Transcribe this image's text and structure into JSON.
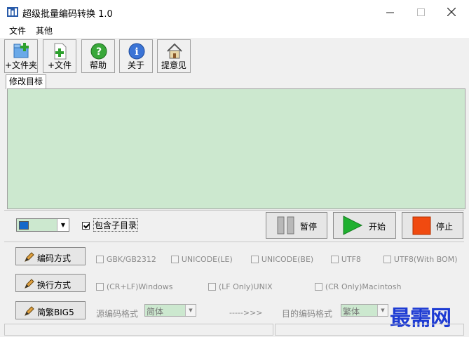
{
  "window": {
    "title": "超级批量编码转换 1.0"
  },
  "menu": [
    "文件",
    "其他"
  ],
  "toolbar": [
    {
      "label": "+文件夹",
      "icon": "add-folder-icon"
    },
    {
      "label": "+文件",
      "icon": "add-file-icon"
    },
    {
      "label": "帮助",
      "icon": "help-icon"
    },
    {
      "label": "关于",
      "icon": "info-icon"
    },
    {
      "label": "提意见",
      "icon": "home-icon"
    }
  ],
  "tab": {
    "label": "修改目标"
  },
  "colors": {
    "panel_bg": "#cce8cf",
    "start_green": "#20b030",
    "stop_orange": "#f04a10",
    "watermark": "#1d3bd3"
  },
  "controls": {
    "include_subdir_label": "包含子目录",
    "include_subdir_checked": true,
    "pause_label": "暂停",
    "start_label": "开始",
    "stop_label": "停止"
  },
  "encoding": {
    "button_label": "编码方式",
    "options": [
      "GBK/GB2312",
      "UNICODE(LE)",
      "UNICODE(BE)",
      "UTF8",
      "UTF8(With BOM)"
    ]
  },
  "newline": {
    "button_label": "换行方式",
    "options": [
      "(CR+LF)Windows",
      "(LF Only)UNIX",
      "(CR Only)Macintosh"
    ]
  },
  "big5": {
    "button_label": "简繁BIG5",
    "source_label": "源编码格式",
    "source_value": "简体",
    "arrow_text": "----->>>",
    "target_label": "目的编码格式",
    "target_value": "繁体"
  },
  "watermark": "最需网"
}
